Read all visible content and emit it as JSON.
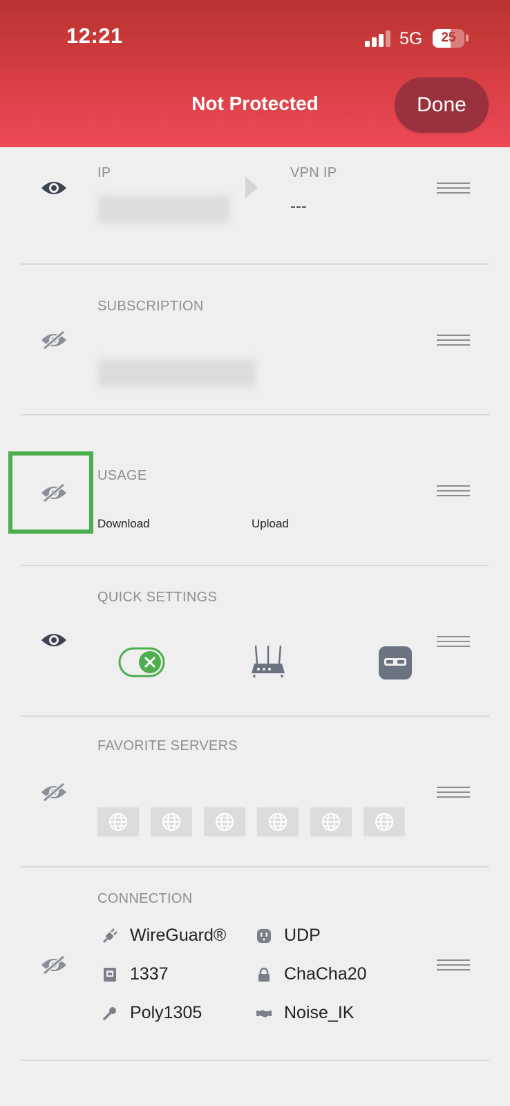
{
  "status_bar": {
    "time": "12:21",
    "network": "5G",
    "battery": "25"
  },
  "header": {
    "title": "Not Protected",
    "done_label": "Done"
  },
  "ip_section": {
    "ip_label": "IP",
    "vpn_ip_label": "VPN IP",
    "vpn_ip_value": "---"
  },
  "subscription_section": {
    "label": "SUBSCRIPTION"
  },
  "usage_section": {
    "label": "USAGE",
    "download_label": "Download",
    "upload_label": "Upload"
  },
  "quick_settings_section": {
    "label": "QUICK SETTINGS"
  },
  "favorite_servers_section": {
    "label": "FAVORITE SERVERS",
    "server_icons": [
      "globe-icon",
      "globe-icon",
      "globe-icon",
      "globe-icon",
      "globe-icon",
      "globe-icon"
    ]
  },
  "connection_section": {
    "label": "CONNECTION",
    "items": [
      {
        "text": "WireGuard®",
        "icon": "plug-icon"
      },
      {
        "text": "UDP",
        "icon": "outlet-icon"
      },
      {
        "text": "1337",
        "icon": "port-icon"
      },
      {
        "text": "ChaCha20",
        "icon": "lock-icon"
      },
      {
        "text": "Poly1305",
        "icon": "key-icon"
      },
      {
        "text": "Noise_IK",
        "icon": "handshake-icon"
      }
    ]
  },
  "colors": {
    "header_top": "#b8332f",
    "header_bottom": "#ec4a57",
    "done_button": "#9a323e",
    "toggle_green": "#4cae4c",
    "highlight_green": "#4cae4c"
  }
}
